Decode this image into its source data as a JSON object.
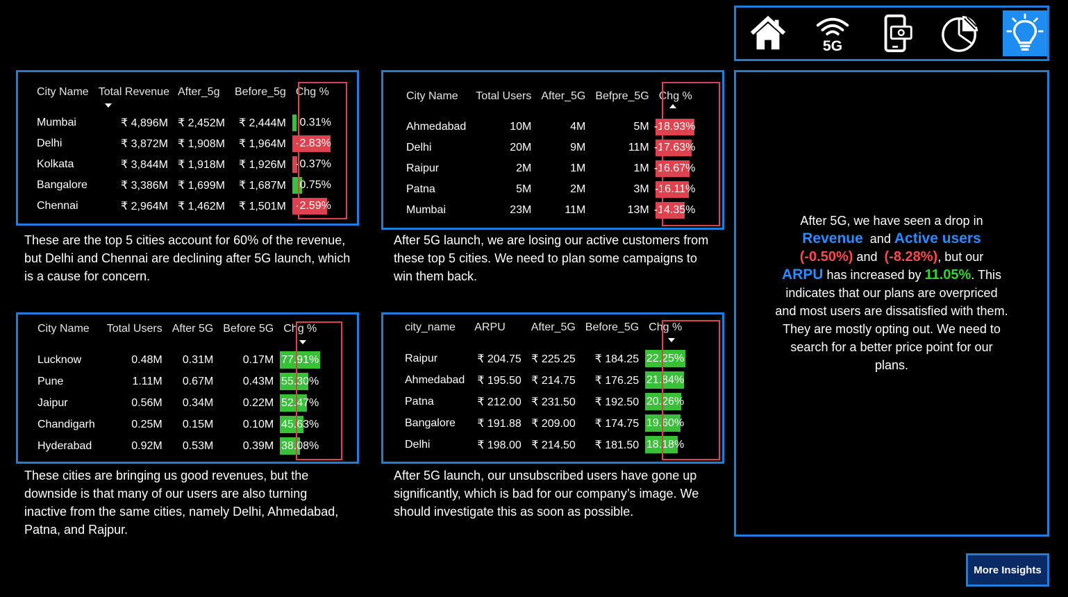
{
  "nav": {
    "items": [
      {
        "icon": "home-icon"
      },
      {
        "icon": "5g-signal-icon",
        "label": "5G"
      },
      {
        "icon": "mobile-payment-icon"
      },
      {
        "icon": "pie-chart-icon"
      },
      {
        "icon": "lightbulb-icon",
        "active": true
      }
    ]
  },
  "colors": {
    "accent": "#1e7fd8",
    "negative": "#e0414f",
    "positive": "#38c038"
  },
  "table1": {
    "headers": [
      "City Name",
      "Total Revenue",
      "After_5g",
      "Before_5g",
      "Chg %"
    ],
    "rows": [
      {
        "city": "Mumbai",
        "total": "₹ 4,896M",
        "after": "₹ 2,452M",
        "before": "₹ 2,444M",
        "chg": "0.31%",
        "chg_value": 0.31
      },
      {
        "city": "Delhi",
        "total": "₹ 3,872M",
        "after": "₹ 1,908M",
        "before": "₹ 1,964M",
        "chg": "-2.83%",
        "chg_value": -2.83
      },
      {
        "city": "Kolkata",
        "total": "₹ 3,844M",
        "after": "₹ 1,918M",
        "before": "₹ 1,926M",
        "chg": "-0.37%",
        "chg_value": -0.37
      },
      {
        "city": "Bangalore",
        "total": "₹ 3,386M",
        "after": "₹ 1,699M",
        "before": "₹ 1,687M",
        "chg": "0.75%",
        "chg_value": 0.75
      },
      {
        "city": "Chennai",
        "total": "₹ 2,964M",
        "after": "₹ 1,462M",
        "before": "₹ 1,501M",
        "chg": "-2.59%",
        "chg_value": -2.59
      }
    ],
    "caption": "These are the top 5 cities account for 60% of the revenue, but Delhi and Chennai are declining after 5G launch, which is a cause for concern."
  },
  "table2": {
    "headers": [
      "City Name",
      "Total Users",
      "After_5G",
      "Befpre_5G",
      "Chg %"
    ],
    "rows": [
      {
        "city": "Ahmedabad",
        "total": "10M",
        "after": "4M",
        "before": "5M",
        "chg": "-18.93%",
        "chg_value": -18.93
      },
      {
        "city": "Delhi",
        "total": "20M",
        "after": "9M",
        "before": "11M",
        "chg": "-17.63%",
        "chg_value": -17.63
      },
      {
        "city": "Raipur",
        "total": "2M",
        "after": "1M",
        "before": "1M",
        "chg": "-16.67%",
        "chg_value": -16.67
      },
      {
        "city": "Patna",
        "total": "5M",
        "after": "2M",
        "before": "3M",
        "chg": "-16.11%",
        "chg_value": -16.11
      },
      {
        "city": "Mumbai",
        "total": "23M",
        "after": "11M",
        "before": "13M",
        "chg": "-14.35%",
        "chg_value": -14.35
      }
    ],
    "caption": "After 5G launch, we are losing our active customers from these top 5 cities. We need to plan some campaigns to win them back."
  },
  "table3": {
    "headers": [
      "City Name",
      "Total Users",
      "After 5G",
      "Before 5G",
      "Chg %"
    ],
    "rows": [
      {
        "city": "Lucknow",
        "total": "0.48M",
        "after": "0.31M",
        "before": "0.17M",
        "chg": "77.91%",
        "chg_value": 77.91
      },
      {
        "city": "Pune",
        "total": "1.11M",
        "after": "0.67M",
        "before": "0.43M",
        "chg": "55.30%",
        "chg_value": 55.3
      },
      {
        "city": "Jaipur",
        "total": "0.56M",
        "after": "0.34M",
        "before": "0.22M",
        "chg": "52.47%",
        "chg_value": 52.47
      },
      {
        "city": "Chandigarh",
        "total": "0.25M",
        "after": "0.15M",
        "before": "0.10M",
        "chg": "45.63%",
        "chg_value": 45.63
      },
      {
        "city": "Hyderabad",
        "total": "0.92M",
        "after": "0.53M",
        "before": "0.39M",
        "chg": "38.08%",
        "chg_value": 38.08
      }
    ],
    "caption": "These cities are bringing us good revenues, but the downside is that many of our users are also turning inactive from the same cities, namely Delhi, Ahmedabad, Patna, and Rajpur."
  },
  "table4": {
    "headers": [
      "city_name",
      "ARPU",
      "After_5G",
      "Before_5G",
      "Chg %"
    ],
    "rows": [
      {
        "city": "Raipur",
        "total": "₹ 204.75",
        "after": "₹ 225.25",
        "before": "₹ 184.25",
        "chg": "22.25%",
        "chg_value": 22.25
      },
      {
        "city": "Ahmedabad",
        "total": "₹ 195.50",
        "after": "₹ 214.75",
        "before": "₹ 176.25",
        "chg": "21.84%",
        "chg_value": 21.84
      },
      {
        "city": "Patna",
        "total": "₹ 212.00",
        "after": "₹ 231.50",
        "before": "₹ 192.50",
        "chg": "20.26%",
        "chg_value": 20.26
      },
      {
        "city": "Bangalore",
        "total": "₹ 191.88",
        "after": "₹ 209.00",
        "before": "₹ 174.75",
        "chg": "19.60%",
        "chg_value": 19.6
      },
      {
        "city": "Delhi",
        "total": "₹ 198.00",
        "after": "₹ 214.50",
        "before": "₹ 181.50",
        "chg": "18.18%",
        "chg_value": 18.18
      }
    ],
    "caption": "After 5G launch, our unsubscribed users have gone up significantly, which is bad for our company’s image. We should investigate this as soon as possible."
  },
  "insight": {
    "line1": "After 5G, we have seen a drop in",
    "revenue": "Revenue",
    "and1": "and",
    "active_users": "Active users",
    "revenue_chg": "(-0.50%)",
    "and2": "and",
    "users_chg": "(-8.28%)",
    "but": ", but our",
    "arpu": "ARPU",
    "increased": "has increased by",
    "arpu_chg": "11.05%",
    "rest": ". This indicates that our plans are overpriced and most users are dissatisfied with them. They are mostly opting out. We need to search for a better price point for our plans."
  },
  "more_button": "More Insights"
}
